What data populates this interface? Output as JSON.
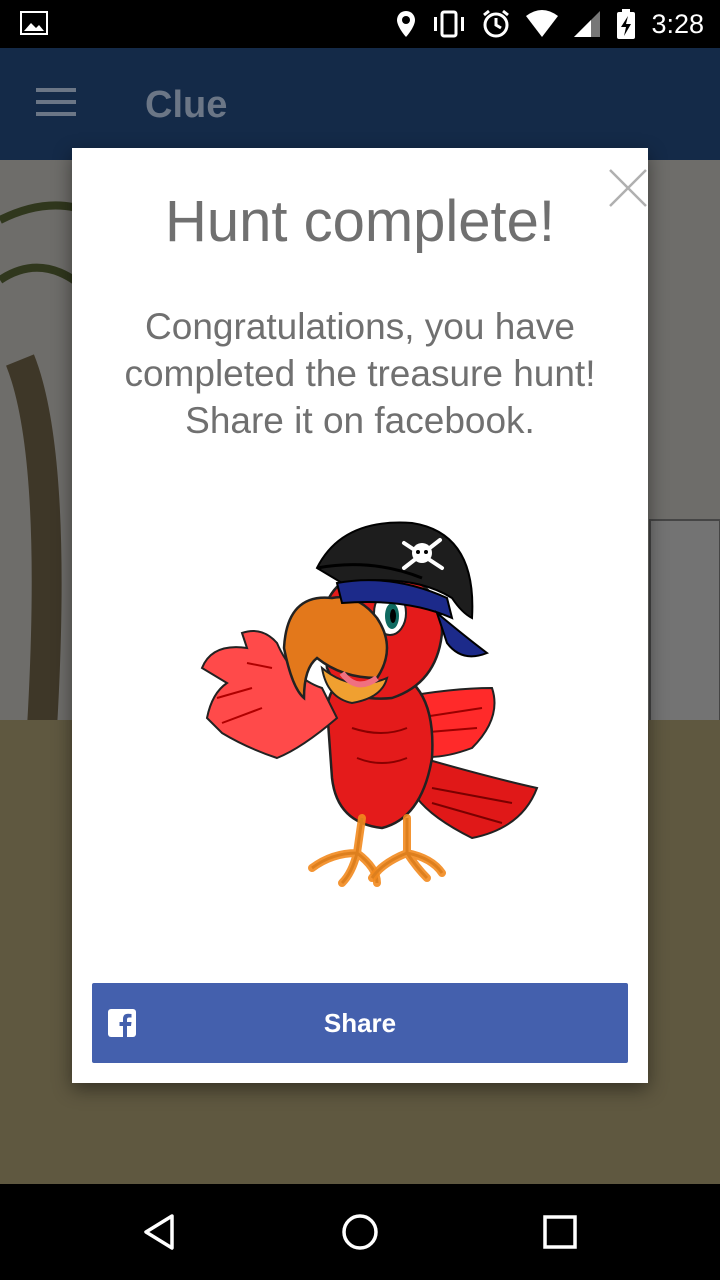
{
  "status_bar": {
    "time": "3:28",
    "icons": [
      "image-icon",
      "location-icon",
      "vibrate-icon",
      "alarm-icon",
      "wifi-icon",
      "signal-icon",
      "battery-charging-icon"
    ]
  },
  "app_bar": {
    "title": "Clue"
  },
  "dialog": {
    "title": "Hunt complete!",
    "message": "Congratulations, you have completed the treasure hunt! Share it on facebook.",
    "share_label": "Share",
    "close_icon": "close-icon",
    "facebook_icon": "facebook-icon",
    "illustration": "pirate-parrot"
  },
  "colors": {
    "app_bar": "#142a48",
    "share_button": "#4460ad",
    "dialog_text": "#707070"
  },
  "nav_bar": {
    "buttons": [
      "back-icon",
      "home-icon",
      "recents-icon"
    ]
  }
}
